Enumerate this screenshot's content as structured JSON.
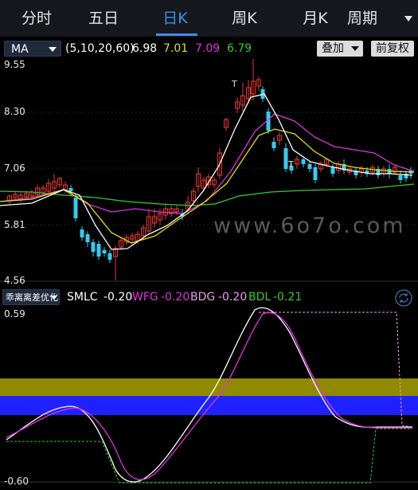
{
  "tabs": [
    {
      "label": "分时"
    },
    {
      "label": "五日"
    },
    {
      "label": "日K"
    },
    {
      "label": "周K"
    },
    {
      "label": "月K"
    },
    {
      "label": "周期"
    }
  ],
  "active_tab": "日K",
  "ma_bar": {
    "selector": "MA",
    "params": "(5,10,20,60)",
    "values": [
      {
        "value": "6.98",
        "color": "#ffffff"
      },
      {
        "value": "7.01",
        "color": "#e6e000"
      },
      {
        "value": "7.09",
        "color": "#e033e0"
      },
      {
        "value": "6.79",
        "color": "#33cc33"
      }
    ],
    "overlay_button": "叠加",
    "adjust_button": "前复权"
  },
  "price_axis": {
    "ticks": [
      "9.55",
      "8.30",
      "7.06",
      "5.81",
      "4.56"
    ]
  },
  "watermark": "www.6o7o.com",
  "indicator": {
    "selector": "乖离离差优化",
    "lines": [
      {
        "name": "SMLC",
        "value": "-0.20",
        "color": "#ffffff"
      },
      {
        "name": "WFG",
        "value": "-0.20",
        "color": "#e033e0"
      },
      {
        "name": "BDG",
        "value": "-0.20",
        "color": "#e6a0e6"
      },
      {
        "name": "BDL",
        "value": "-0.21",
        "color": "#33cc33"
      }
    ],
    "axis": {
      "top": "0.59",
      "bottom": "-0.60"
    },
    "bands": [
      {
        "name": "upper-band",
        "color": "#8f8a00"
      },
      {
        "name": "lower-band",
        "color": "#1f22ff"
      }
    ]
  },
  "colors": {
    "up": "#e53935",
    "down": "#33ccee",
    "ma5": "#ffffff",
    "ma10": "#e6e000",
    "ma20": "#e033e0",
    "ma60": "#33cc33",
    "accent": "#3e8ff0"
  }
}
